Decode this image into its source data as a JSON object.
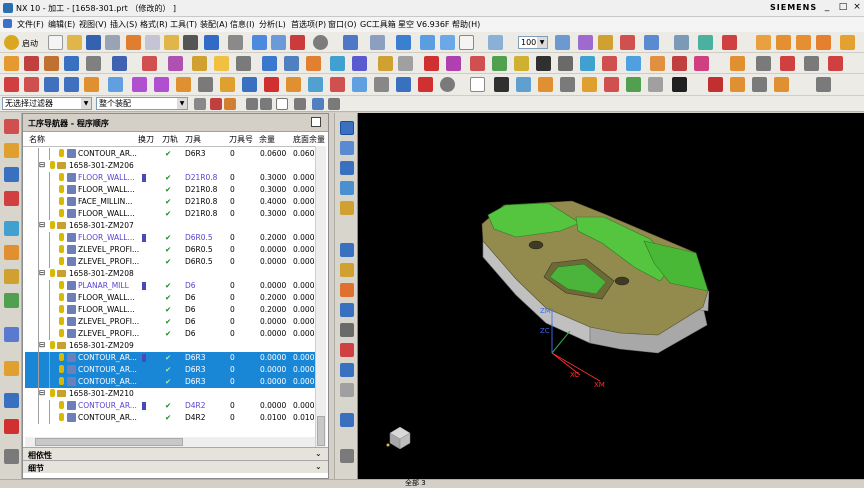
{
  "window": {
    "title": "NX 10 - 加工 - [1658-301.prt （修改的） ]",
    "brand": "SIEMENS",
    "controls": [
      "_",
      "□",
      "×"
    ]
  },
  "menu": [
    "文件(F)",
    "编辑(E)",
    "视图(V)",
    "插入(S)",
    "格式(R)",
    "工具(T)",
    "装配(A)",
    "信息(I)",
    "分析(L)",
    "首选项(P)",
    "窗口(O)",
    "GC工具箱",
    "星空 V6.936F",
    "帮助(H)"
  ],
  "toolbar": {
    "start_label": "启动",
    "zoom_value": "100"
  },
  "filterbar": {
    "filter_value": "无选择过滤器",
    "assembly_value": "整个装配"
  },
  "navigator": {
    "title": "工序导航器 - 程序顺序",
    "columns": [
      "名称",
      "换刀",
      "刀轨",
      "刀具",
      "刀具号",
      "余量",
      "底面余量"
    ],
    "rows": [
      {
        "kind": "op",
        "name": "CONTOUR_AR...",
        "tc": false,
        "ok": true,
        "tool": "D6R3",
        "num": "0",
        "stock": "0.0600",
        "floor": "0.060",
        "sel": false,
        "pur": false
      },
      {
        "kind": "grp",
        "name": "1658-301-ZM206"
      },
      {
        "kind": "op",
        "name": "FLOOR_WALL...",
        "tc": true,
        "ok": true,
        "tool": "D21R0.8",
        "num": "0",
        "stock": "0.3000",
        "floor": "0.0000",
        "sel": false,
        "pur": true
      },
      {
        "kind": "op",
        "name": "FLOOR_WALL...",
        "tc": false,
        "ok": true,
        "tool": "D21R0.8",
        "num": "0",
        "stock": "0.3000",
        "floor": "0.0000",
        "sel": false,
        "pur": false
      },
      {
        "kind": "op",
        "name": "FACE_MILLIN...",
        "tc": false,
        "ok": true,
        "tool": "D21R0.8",
        "num": "0",
        "stock": "0.4000",
        "floor": "0.0000",
        "sel": false,
        "pur": false
      },
      {
        "kind": "op",
        "name": "FLOOR_WALL...",
        "tc": false,
        "ok": true,
        "tool": "D21R0.8",
        "num": "0",
        "stock": "0.3000",
        "floor": "0.0000",
        "sel": false,
        "pur": false
      },
      {
        "kind": "grp",
        "name": "1658-301-ZM207"
      },
      {
        "kind": "op",
        "name": "FLOOR_WALL...",
        "tc": true,
        "ok": true,
        "tool": "D6R0.5",
        "num": "0",
        "stock": "0.2000",
        "floor": "0.0000",
        "sel": false,
        "pur": true
      },
      {
        "kind": "op",
        "name": "ZLEVEL_PROFI...",
        "tc": false,
        "ok": true,
        "tool": "D6R0.5",
        "num": "0",
        "stock": "0.0000",
        "floor": "0.0000",
        "sel": false,
        "pur": false
      },
      {
        "kind": "op",
        "name": "ZLEVEL_PROFI...",
        "tc": false,
        "ok": true,
        "tool": "D6R0.5",
        "num": "0",
        "stock": "0.0000",
        "floor": "0.0000",
        "sel": false,
        "pur": false
      },
      {
        "kind": "grp",
        "name": "1658-301-ZM208"
      },
      {
        "kind": "op",
        "name": "PLANAR_MILL",
        "tc": true,
        "ok": true,
        "tool": "D6",
        "num": "0",
        "stock": "0.0000",
        "floor": "0.0000",
        "sel": false,
        "pur": true
      },
      {
        "kind": "op",
        "name": "FLOOR_WALL...",
        "tc": false,
        "ok": true,
        "tool": "D6",
        "num": "0",
        "stock": "0.2000",
        "floor": "0.0000",
        "sel": false,
        "pur": false
      },
      {
        "kind": "op",
        "name": "FLOOR_WALL...",
        "tc": false,
        "ok": true,
        "tool": "D6",
        "num": "0",
        "stock": "0.2000",
        "floor": "0.0000",
        "sel": false,
        "pur": false
      },
      {
        "kind": "op",
        "name": "ZLEVEL_PROFI...",
        "tc": false,
        "ok": true,
        "tool": "D6",
        "num": "0",
        "stock": "0.0000",
        "floor": "0.0000",
        "sel": false,
        "pur": false
      },
      {
        "kind": "op",
        "name": "ZLEVEL_PROFI...",
        "tc": false,
        "ok": true,
        "tool": "D6",
        "num": "0",
        "stock": "0.0000",
        "floor": "0.0000",
        "sel": false,
        "pur": false
      },
      {
        "kind": "grp",
        "name": "1658-301-ZM209"
      },
      {
        "kind": "op",
        "name": "CONTOUR_AR...",
        "tc": true,
        "ok": true,
        "tool": "D6R3",
        "num": "0",
        "stock": "0.0000",
        "floor": "0.0000",
        "sel": true,
        "pur": true
      },
      {
        "kind": "op",
        "name": "CONTOUR_AR...",
        "tc": false,
        "ok": true,
        "tool": "D6R3",
        "num": "0",
        "stock": "0.0000",
        "floor": "0.0000",
        "sel": true,
        "pur": false
      },
      {
        "kind": "op",
        "name": "CONTOUR_AR...",
        "tc": false,
        "ok": true,
        "tool": "D6R3",
        "num": "0",
        "stock": "0.0000",
        "floor": "0.0000",
        "sel": true,
        "pur": false
      },
      {
        "kind": "grp",
        "name": "1658-301-ZM210"
      },
      {
        "kind": "op",
        "name": "CONTOUR_AR...",
        "tc": true,
        "ok": true,
        "tool": "D4R2",
        "num": "0",
        "stock": "0.0000",
        "floor": "0.0000",
        "sel": false,
        "pur": true
      },
      {
        "kind": "op",
        "name": "CONTOUR_AR...",
        "tc": false,
        "ok": true,
        "tool": "D4R2",
        "num": "0",
        "stock": "0.0100",
        "floor": "0.010",
        "sel": false,
        "pur": false
      }
    ],
    "dependencies_label": "相依性",
    "details_label": "细节"
  },
  "viewport": {
    "axis_labels": {
      "zm": "ZM",
      "zc": "ZC",
      "xc": "XC",
      "xm": "XM"
    }
  },
  "status": {
    "text": "全部 3"
  },
  "colors": {
    "selection": "#1a86d6",
    "part_body": "#8f8a4e",
    "part_top": "#49c23a",
    "viewport_bg": "#000000"
  }
}
